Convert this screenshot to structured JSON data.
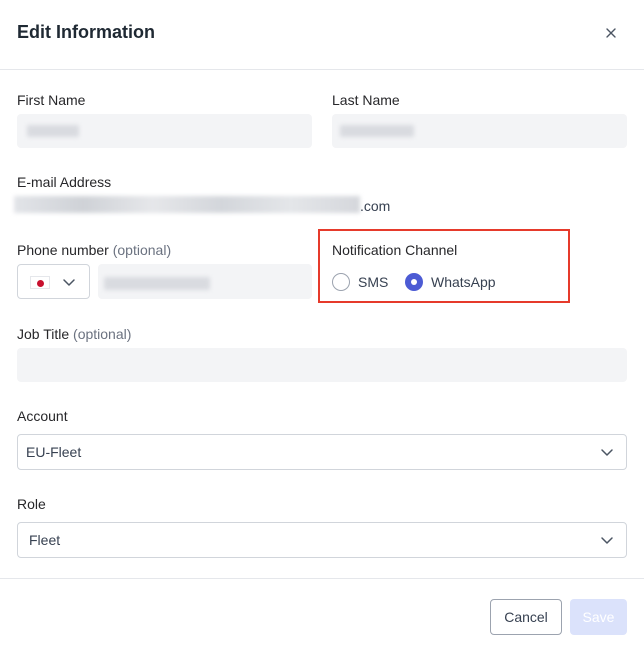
{
  "dialog": {
    "title": "Edit Information",
    "close_icon": "close-icon"
  },
  "form": {
    "first_name": {
      "label": "First Name",
      "value": ""
    },
    "last_name": {
      "label": "Last Name",
      "value": ""
    },
    "email": {
      "label": "E-mail Address",
      "suffix": ".com"
    },
    "phone": {
      "label": "Phone number",
      "optional": "(optional)",
      "country_flag": "japan-flag-icon",
      "value": ""
    },
    "notification": {
      "label": "Notification Channel",
      "options": [
        "SMS",
        "WhatsApp"
      ],
      "selected": "WhatsApp"
    },
    "job_title": {
      "label": "Job Title",
      "optional": "(optional)",
      "value": ""
    },
    "account": {
      "label": "Account",
      "value": "EU-Fleet"
    },
    "role": {
      "label": "Role",
      "value": "Fleet"
    }
  },
  "footer": {
    "cancel_label": "Cancel",
    "save_label": "Save"
  },
  "colors": {
    "accent": "#4c5bd4",
    "highlight_box": "#e63a2b",
    "save_disabled": "#dbe2fb"
  }
}
